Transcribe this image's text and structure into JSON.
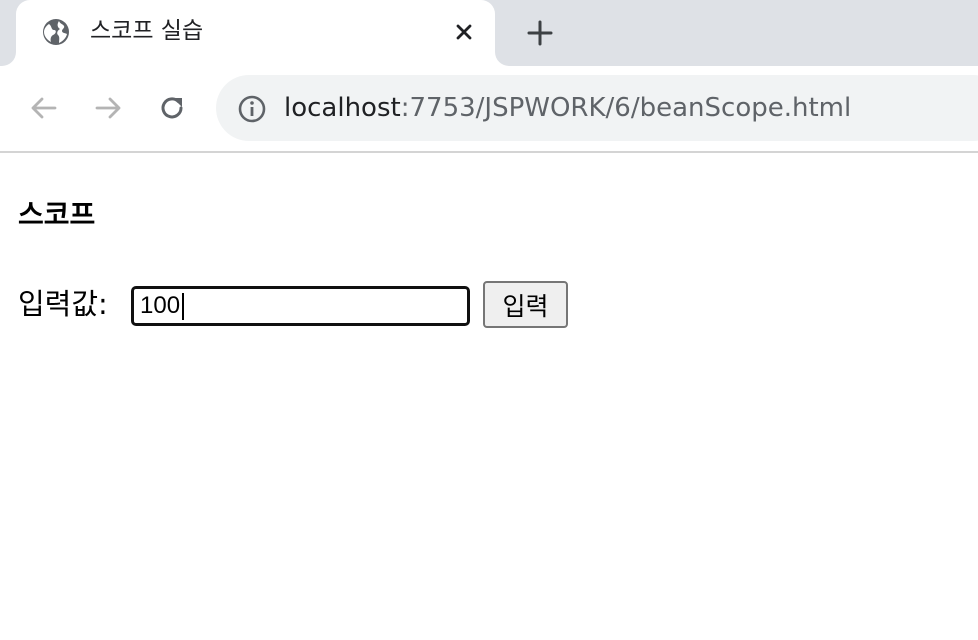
{
  "browser": {
    "tab": {
      "title": "스코프 실습",
      "favicon_icon": "globe-icon",
      "close_icon": "close-icon"
    },
    "new_tab_icon": "plus-icon",
    "nav": {
      "back_icon": "arrow-left-icon",
      "forward_icon": "arrow-right-icon",
      "reload_icon": "reload-icon"
    },
    "address_bar": {
      "info_icon": "info-icon",
      "host": "localhost",
      "path": ":7753/JSPWORK/6/beanScope.html"
    }
  },
  "page": {
    "heading": "스코프",
    "form": {
      "label": "입력값:",
      "input_value": "100",
      "submit_label": "입력"
    }
  },
  "colors": {
    "tabstrip_bg": "#dee1e6",
    "omnibox_bg": "#f1f3f4",
    "text_primary": "#202124",
    "text_secondary": "#5f6368",
    "icon_disabled": "#b4b4b4"
  }
}
